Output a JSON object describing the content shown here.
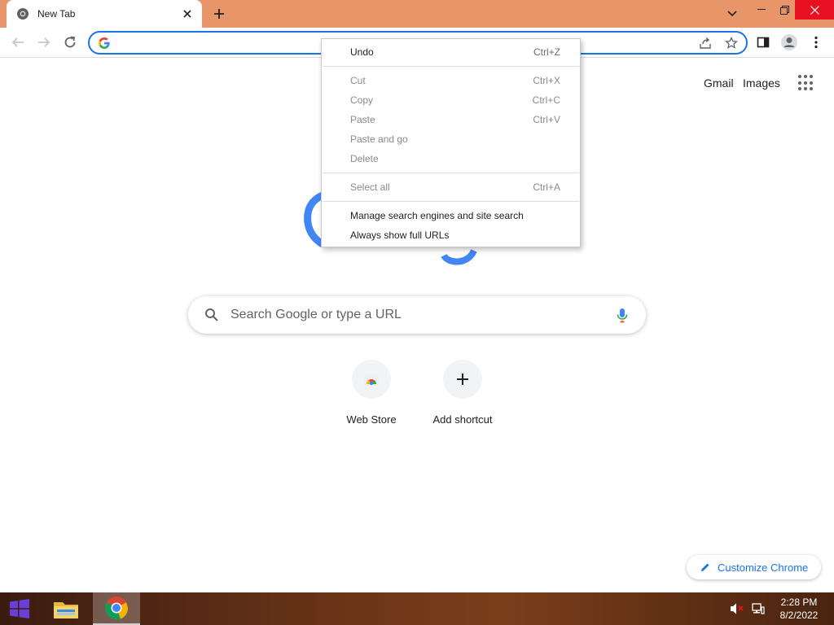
{
  "browser": {
    "tab": {
      "title": "New Tab"
    },
    "omnibox": {
      "value": ""
    }
  },
  "ntp": {
    "header_links": {
      "gmail": "Gmail",
      "images": "Images"
    },
    "search": {
      "placeholder": "Search Google or type a URL"
    },
    "shortcuts": [
      {
        "label": "Web Store",
        "icon": "web-store-icon"
      },
      {
        "label": "Add shortcut",
        "icon": "plus-icon"
      }
    ],
    "customize_label": "Customize Chrome"
  },
  "context_menu": {
    "items": [
      {
        "label": "Undo",
        "shortcut": "Ctrl+Z",
        "enabled": true
      },
      {
        "label": "Cut",
        "shortcut": "Ctrl+X",
        "enabled": false
      },
      {
        "label": "Copy",
        "shortcut": "Ctrl+C",
        "enabled": false
      },
      {
        "label": "Paste",
        "shortcut": "Ctrl+V",
        "enabled": false
      },
      {
        "label": "Paste and go",
        "shortcut": "",
        "enabled": false
      },
      {
        "label": "Delete",
        "shortcut": "",
        "enabled": false
      },
      {
        "label": "Select all",
        "shortcut": "Ctrl+A",
        "enabled": false
      },
      {
        "label": "Manage search engines and site search",
        "shortcut": "",
        "enabled": true
      },
      {
        "label": "Always show full URLs",
        "shortcut": "",
        "enabled": true
      }
    ]
  },
  "taskbar": {
    "time": "2:28 PM",
    "date": "8/2/2022",
    "apps": [
      "windows-start-icon",
      "file-explorer-icon",
      "chrome-icon"
    ]
  },
  "colors": {
    "titlebar": "#e8956a",
    "accent": "#1a73e8",
    "close_button": "#e81123"
  }
}
